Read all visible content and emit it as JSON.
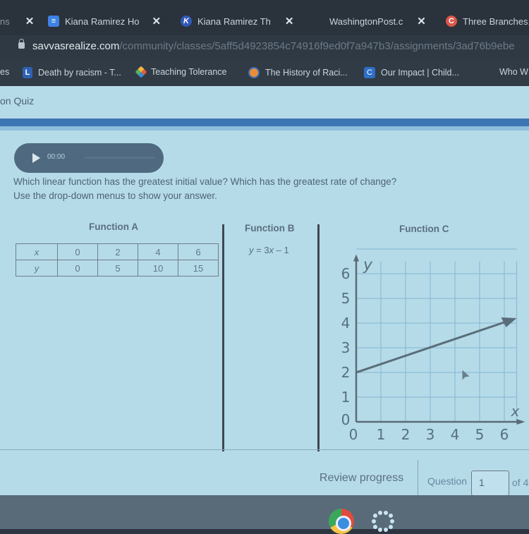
{
  "browser": {
    "tabs": [
      {
        "label": "ns",
        "icon": "partial-tab",
        "close": "✕"
      },
      {
        "label": "Kiana Ramirez  Ho",
        "icon": "docs-icon",
        "close": "✕"
      },
      {
        "label": "Kiana Ramirez  Th",
        "icon": "k-icon",
        "close": "✕"
      },
      {
        "label": "WashingtonPost.c",
        "icon": "",
        "close": "✕"
      },
      {
        "label": "Three Branches.",
        "icon": "c-icon",
        "close": ""
      }
    ],
    "url_domain": "savvasrealize.com",
    "url_path": "/community/classes/5aff5d4923854c74916f9ed0f7a947b3/assignments/3ad76b9ebe",
    "bookmarks": [
      {
        "label": "es"
      },
      {
        "label": "Death by racism - T...",
        "icon": "L"
      },
      {
        "label": "Teaching Tolerance",
        "icon": "tt"
      },
      {
        "label": "The History of Raci...",
        "icon": "dot"
      },
      {
        "label": "Our Impact | Child...",
        "icon": "C"
      },
      {
        "label": "Who W",
        "icon": ""
      }
    ]
  },
  "quiz": {
    "title": "on Quiz",
    "audio": {
      "time": "00:00"
    },
    "prompt_line1": "Which linear function has the greatest initial value? Which has the greatest rate of change?",
    "prompt_line2": "Use the drop-down menus to show your answer.",
    "function_a": {
      "title": "Function A",
      "row_x": {
        "label": "x",
        "values": [
          "0",
          "2",
          "4",
          "6"
        ]
      },
      "row_y": {
        "label": "y",
        "values": [
          "0",
          "5",
          "10",
          "15"
        ]
      }
    },
    "function_b": {
      "title": "Function B",
      "equation_y": "y",
      "equation_eq": " = 3",
      "equation_x": "x",
      "equation_rest": " – 1"
    },
    "function_c": {
      "title": "Function C"
    }
  },
  "chart_data": {
    "type": "line",
    "title": "Function C",
    "xlabel": "x",
    "ylabel": "y",
    "xlim": [
      0,
      6.5
    ],
    "ylim": [
      0,
      6.5
    ],
    "x_ticks": [
      "0",
      "1",
      "2",
      "3",
      "4",
      "5",
      "6"
    ],
    "y_ticks": [
      "0",
      "1",
      "2",
      "3",
      "4",
      "5",
      "6"
    ],
    "grid": true,
    "series": [
      {
        "name": "Function C",
        "points": [
          [
            0,
            2
          ],
          [
            6.5,
            4.2
          ]
        ],
        "arrow_end": true
      }
    ]
  },
  "footer": {
    "review_label": "Review progress",
    "question_label": "Question",
    "question_value": "1",
    "of_label": "of 4"
  }
}
